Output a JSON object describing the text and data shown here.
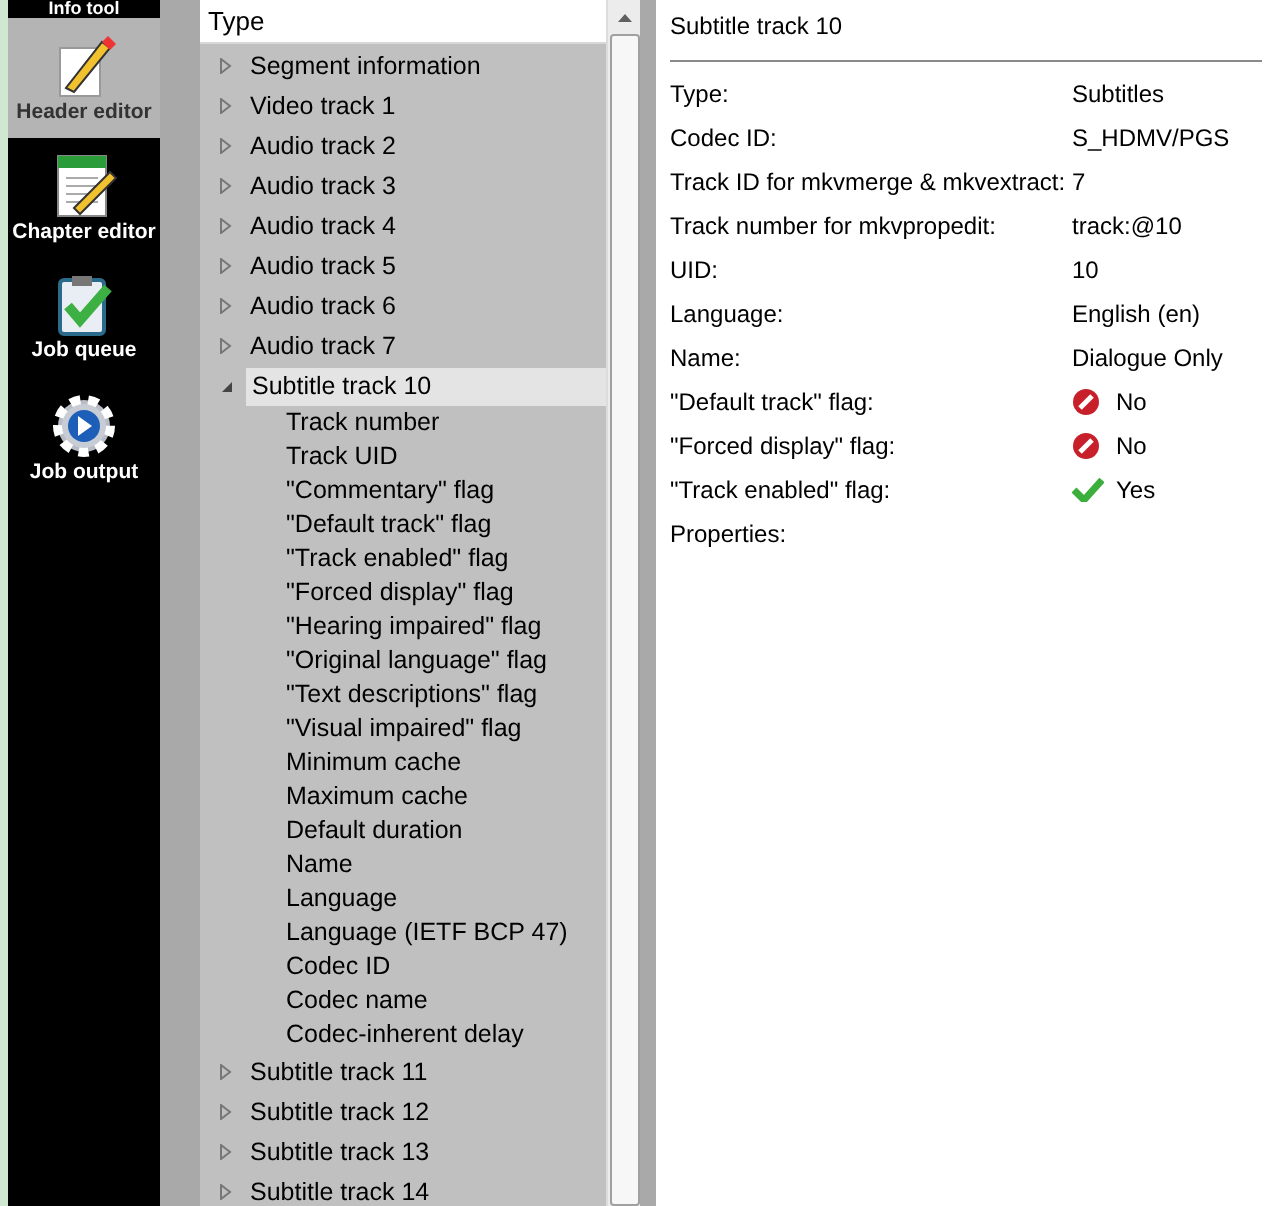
{
  "sidebar": {
    "items": [
      {
        "label": "Info tool",
        "selected": false
      },
      {
        "label": "Header editor",
        "selected": true
      },
      {
        "label": "Chapter editor",
        "selected": false
      },
      {
        "label": "Job queue",
        "selected": false
      },
      {
        "label": "Job output",
        "selected": false
      }
    ]
  },
  "tree": {
    "header": "Type",
    "items": [
      {
        "label": "Segment information",
        "expanded": false,
        "selected": false
      },
      {
        "label": "Video track 1",
        "expanded": false,
        "selected": false
      },
      {
        "label": "Audio track 2",
        "expanded": false,
        "selected": false
      },
      {
        "label": "Audio track 3",
        "expanded": false,
        "selected": false
      },
      {
        "label": "Audio track 4",
        "expanded": false,
        "selected": false
      },
      {
        "label": "Audio track 5",
        "expanded": false,
        "selected": false
      },
      {
        "label": "Audio track 6",
        "expanded": false,
        "selected": false
      },
      {
        "label": "Audio track 7",
        "expanded": false,
        "selected": false
      },
      {
        "label": "Subtitle track 10",
        "expanded": true,
        "selected": true,
        "children": [
          {
            "label": "Track number"
          },
          {
            "label": "Track UID"
          },
          {
            "label": "\"Commentary\" flag"
          },
          {
            "label": "\"Default track\" flag"
          },
          {
            "label": "\"Track enabled\" flag"
          },
          {
            "label": "\"Forced display\" flag"
          },
          {
            "label": "\"Hearing impaired\" flag"
          },
          {
            "label": "\"Original language\" flag"
          },
          {
            "label": "\"Text descriptions\" flag"
          },
          {
            "label": "\"Visual impaired\" flag"
          },
          {
            "label": "Minimum cache"
          },
          {
            "label": "Maximum cache"
          },
          {
            "label": "Default duration"
          },
          {
            "label": "Name"
          },
          {
            "label": "Language"
          },
          {
            "label": "Language (IETF BCP 47)"
          },
          {
            "label": "Codec ID"
          },
          {
            "label": "Codec name"
          },
          {
            "label": "Codec-inherent delay"
          }
        ]
      },
      {
        "label": "Subtitle track 11",
        "expanded": false,
        "selected": false
      },
      {
        "label": "Subtitle track 12",
        "expanded": false,
        "selected": false
      },
      {
        "label": "Subtitle track 13",
        "expanded": false,
        "selected": false
      },
      {
        "label": "Subtitle track 14",
        "expanded": false,
        "selected": false
      }
    ]
  },
  "details": {
    "title": "Subtitle track 10",
    "rows": [
      {
        "label": "Type:",
        "value": "Subtitles"
      },
      {
        "label": "Codec ID:",
        "value": "S_HDMV/PGS"
      },
      {
        "label": "Track ID for mkvmerge & mkvextract:",
        "value": "7"
      },
      {
        "label": "Track number for mkvpropedit:",
        "value": "track:@10"
      },
      {
        "label": "UID:",
        "value": "10"
      },
      {
        "label": "Language:",
        "value": "English (en)"
      },
      {
        "label": "Name:",
        "value": "Dialogue Only"
      },
      {
        "label": "\"Default track\" flag:",
        "value": "No",
        "kind": "flag",
        "on": false
      },
      {
        "label": "\"Forced display\" flag:",
        "value": "No",
        "kind": "flag",
        "on": false
      },
      {
        "label": "\"Track enabled\" flag:",
        "value": "Yes",
        "kind": "flag",
        "on": true
      },
      {
        "label": "Properties:"
      }
    ]
  }
}
